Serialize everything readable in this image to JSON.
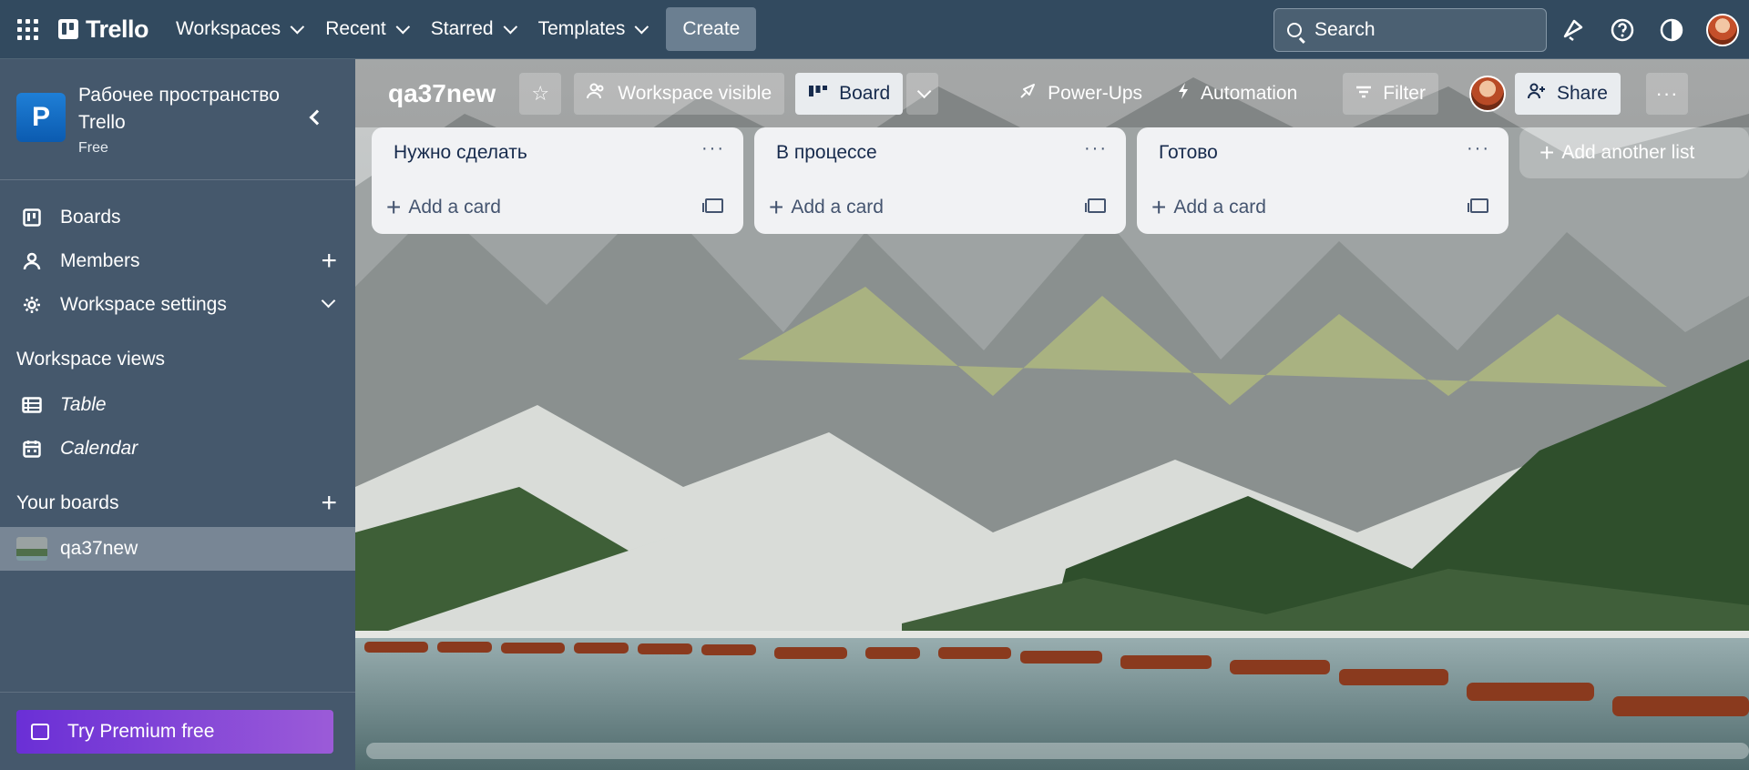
{
  "header": {
    "logo": "Trello",
    "nav": [
      {
        "label": "Workspaces"
      },
      {
        "label": "Recent"
      },
      {
        "label": "Starred"
      },
      {
        "label": "Templates"
      }
    ],
    "create_label": "Create",
    "search_placeholder": "Search"
  },
  "sidebar": {
    "workspace_initial": "P",
    "workspace_name": "Рабочее пространство Trello",
    "workspace_plan": "Free",
    "items": [
      {
        "label": "Boards",
        "icon": "board-icon"
      },
      {
        "label": "Members",
        "icon": "member-icon"
      },
      {
        "label": "Workspace settings",
        "icon": "gear-icon"
      }
    ],
    "views_heading": "Workspace views",
    "views": [
      {
        "label": "Table",
        "icon": "table-icon"
      },
      {
        "label": "Calendar",
        "icon": "calendar-icon"
      }
    ],
    "boards_heading": "Your boards",
    "boards": [
      {
        "label": "qa37new"
      }
    ],
    "premium_label": "Try Premium free"
  },
  "board": {
    "title": "qa37new",
    "visibility_label": "Workspace visible",
    "view_label": "Board",
    "powerups_label": "Power-Ups",
    "automation_label": "Automation",
    "filter_label": "Filter",
    "share_label": "Share"
  },
  "lists": [
    {
      "title": "Нужно сделать",
      "add_label": "Add a card"
    },
    {
      "title": "В процессе",
      "add_label": "Add a card"
    },
    {
      "title": "Готово",
      "add_label": "Add a card"
    }
  ],
  "add_list_label": "Add another list",
  "colors": {
    "header_bg": "#324a5f",
    "premium_start": "#6a2fd6",
    "premium_end": "#9b5bd8",
    "workspace_logo": "#1f7fd6",
    "list_bg": "#f1f2f4"
  }
}
